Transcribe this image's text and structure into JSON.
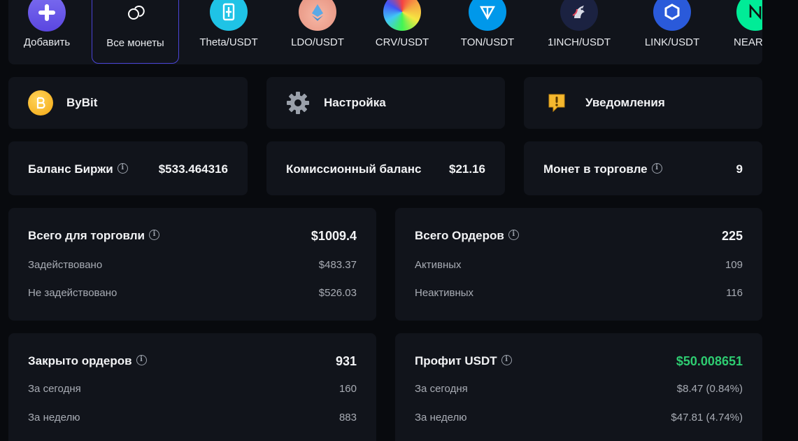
{
  "coins": [
    {
      "label": "Добавить",
      "icon": "plus-icon",
      "color": "#6c5ce7"
    },
    {
      "label": "Все монеты",
      "icon": "coins-icon",
      "color": "#11141b",
      "active": true
    },
    {
      "label": "Theta/USDT",
      "icon": "theta-logo-icon",
      "color": "#1fc3e6"
    },
    {
      "label": "LDO/USDT",
      "icon": "lido-logo-icon",
      "color": "#f0a496"
    },
    {
      "label": "CRV/USDT",
      "icon": "curve-logo-icon",
      "color": "#e6e6e6"
    },
    {
      "label": "TON/USDT",
      "icon": "ton-logo-icon",
      "color": "#0098ea"
    },
    {
      "label": "1INCH/USDT",
      "icon": "1inch-logo-icon",
      "color": "#1b2241"
    },
    {
      "label": "LINK/USDT",
      "icon": "chainlink-logo-icon",
      "color": "#2a5ada"
    },
    {
      "label": "NEAR/USDT",
      "icon": "near-logo-icon",
      "color": "#00ec97"
    }
  ],
  "exchange": {
    "label": "ByBit",
    "icon": "bybit-coin-icon"
  },
  "settings": {
    "label": "Настройка",
    "icon": "gear-icon"
  },
  "notifications": {
    "label": "Уведомления",
    "icon": "alert-icon"
  },
  "balance": {
    "label": "Баланс Биржи",
    "value": "$533.464316"
  },
  "commission": {
    "label": "Комиссионный баланс",
    "value": "$21.16"
  },
  "coins_trading": {
    "label": "Монет в торговле",
    "value": "9"
  },
  "trading_total": {
    "title": "Всего для торговли",
    "total": "$1009.4",
    "rows": [
      {
        "label": "Задействовано",
        "value": "$483.37"
      },
      {
        "label": "Не задействовано",
        "value": "$526.03"
      }
    ]
  },
  "orders_total": {
    "title": "Всего Ордеров",
    "total": "225",
    "rows": [
      {
        "label": "Активных",
        "value": "109"
      },
      {
        "label": "Неактивных",
        "value": "116"
      }
    ]
  },
  "closed_orders": {
    "title": "Закрыто ордеров",
    "total": "931",
    "rows": [
      {
        "label": "За сегодня",
        "value": "160"
      },
      {
        "label": "За неделю",
        "value": "883"
      }
    ]
  },
  "profit": {
    "title": "Профит USDT",
    "total": "$50.008651",
    "total_color": "#2ecc71",
    "rows": [
      {
        "label": "За сегодня",
        "value": "$8.47 (0.84%)"
      },
      {
        "label": "За неделю",
        "value": "$47.81 (4.74%)"
      }
    ]
  }
}
